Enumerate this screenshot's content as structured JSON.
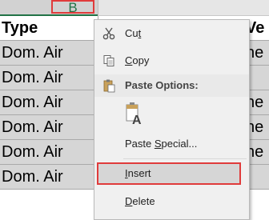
{
  "columns": {
    "b_letter": "B"
  },
  "table": {
    "header_b": "Type",
    "header_c": "Ve",
    "rows": [
      {
        "b": "Dom. Air",
        "c": "ne"
      },
      {
        "b": "Dom. Air",
        "c": ""
      },
      {
        "b": "Dom. Air",
        "c": "ne"
      },
      {
        "b": "Dom. Air",
        "c": "ne"
      },
      {
        "b": "Dom. Air",
        "c": "ne"
      },
      {
        "b": "Dom. Air",
        "c": ""
      }
    ]
  },
  "context_menu": {
    "cut": {
      "prefix": "Cu",
      "hotkey": "t",
      "suffix": "",
      "icon": "scissors-icon"
    },
    "copy": {
      "prefix": "",
      "hotkey": "C",
      "suffix": "opy",
      "icon": "copy-icon"
    },
    "paste_options_header": "Paste Options:",
    "paste_option_icon": "paste-values-icon",
    "paste_option_letter": "A",
    "paste_special": {
      "prefix": "Paste ",
      "hotkey": "S",
      "suffix": "pecial..."
    },
    "insert": {
      "prefix": "",
      "hotkey": "I",
      "suffix": "nsert"
    },
    "delete": {
      "prefix": "",
      "hotkey": "D",
      "suffix": "elete"
    }
  },
  "colors": {
    "accent": "#217346",
    "highlight_border": "#e03b3b"
  }
}
